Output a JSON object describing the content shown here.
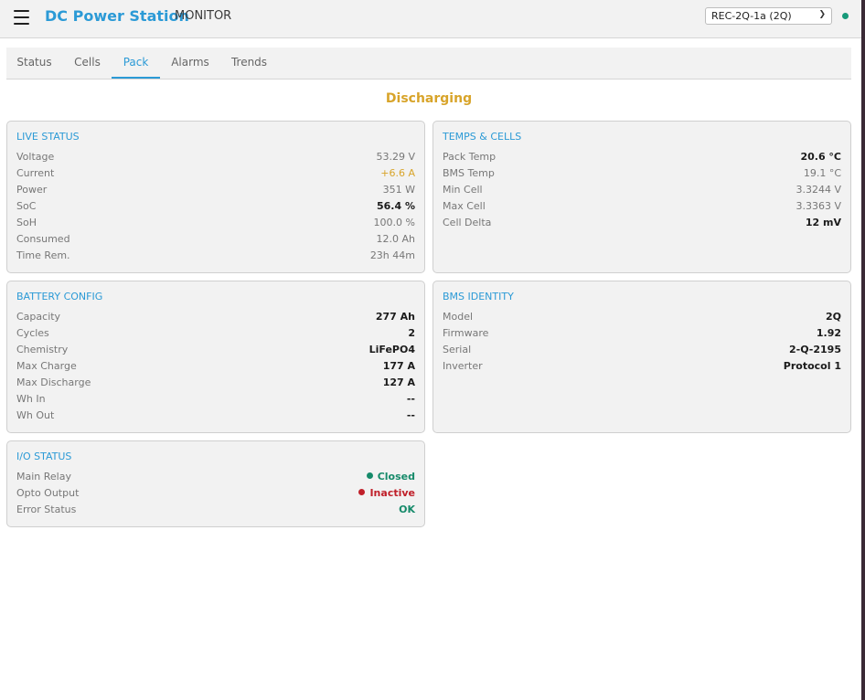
{
  "header": {
    "title": "DC Power Station",
    "subtitle": "MONITOR",
    "device_select": "REC-2Q-1a (2Q)"
  },
  "colors": {
    "accent": "#2b9ad6",
    "warning": "#d8a42a",
    "ok": "#168a6a",
    "error": "#c0202a"
  },
  "tabs": [
    {
      "label": "Status"
    },
    {
      "label": "Cells"
    },
    {
      "label": "Pack",
      "active": true
    },
    {
      "label": "Alarms"
    },
    {
      "label": "Trends"
    }
  ],
  "state": "Discharging",
  "live_status": {
    "title": "LIVE STATUS",
    "rows": [
      {
        "label": "Voltage",
        "value": "53.29 V"
      },
      {
        "label": "Current",
        "value": "+6.6 A"
      },
      {
        "label": "Power",
        "value": "351 W"
      },
      {
        "label": "SoC",
        "value": "56.4 %"
      },
      {
        "label": "SoH",
        "value": "100.0 %"
      },
      {
        "label": "Consumed",
        "value": "12.0 Ah"
      },
      {
        "label": "Time Rem.",
        "value": "23h 44m"
      }
    ]
  },
  "temps_cells": {
    "title": "TEMPS & CELLS",
    "rows": [
      {
        "label": "Pack Temp",
        "value": "20.6 °C"
      },
      {
        "label": "BMS Temp",
        "value": "19.1 °C"
      },
      {
        "label": "Min Cell",
        "value": "3.3244 V"
      },
      {
        "label": "Max Cell",
        "value": "3.3363 V"
      },
      {
        "label": "Cell Delta",
        "value": "12 mV"
      }
    ]
  },
  "battery_config": {
    "title": "BATTERY CONFIG",
    "rows": [
      {
        "label": "Capacity",
        "value": "277 Ah"
      },
      {
        "label": "Cycles",
        "value": "2"
      },
      {
        "label": "Chemistry",
        "value": "LiFePO4"
      },
      {
        "label": "Max Charge",
        "value": "177 A"
      },
      {
        "label": "Max Discharge",
        "value": "127 A"
      },
      {
        "label": "Wh In",
        "value": "--"
      },
      {
        "label": "Wh Out",
        "value": "--"
      }
    ]
  },
  "bms_identity": {
    "title": "BMS IDENTITY",
    "rows": [
      {
        "label": "Model",
        "value": "2Q"
      },
      {
        "label": "Firmware",
        "value": "1.92"
      },
      {
        "label": "Serial",
        "value": "2-Q-2195"
      },
      {
        "label": "Inverter",
        "value": "Protocol 1"
      }
    ]
  },
  "io_status": {
    "title": "I/O STATUS",
    "rows": [
      {
        "label": "Main Relay",
        "value": "Closed",
        "indicator": "green-dot-icon"
      },
      {
        "label": "Opto Output",
        "value": "Inactive",
        "indicator": "red-dot-icon"
      },
      {
        "label": "Error Status",
        "value": "OK"
      }
    ]
  }
}
